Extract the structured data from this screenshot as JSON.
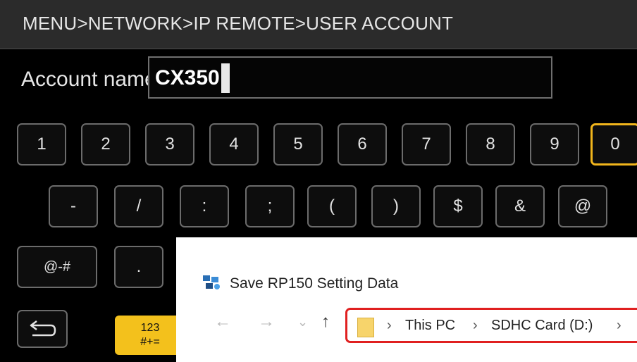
{
  "camera": {
    "breadcrumb": "MENU>NETWORK>IP REMOTE>USER ACCOUNT",
    "account_label": "Account name",
    "account_value": "CX350",
    "keys_row1": [
      "1",
      "2",
      "3",
      "4",
      "5",
      "6",
      "7",
      "8",
      "9",
      "0"
    ],
    "keys_row2": [
      "-",
      "/",
      ":",
      ";",
      "(",
      ")",
      "$",
      "&",
      "@"
    ],
    "keys_row3": [
      "@-#",
      "."
    ],
    "mode_key": {
      "top": "123",
      "bottom": "#+="
    },
    "back_icon": "return-arrow-icon",
    "selected_key": "0",
    "accent_color": "#f1b51c"
  },
  "dialog": {
    "title": "Save RP150 Setting Data",
    "nav": {
      "back": "←",
      "forward": "→",
      "history": "⌄",
      "up": "↑"
    },
    "path": [
      "This PC",
      "SDHC Card (D:)"
    ],
    "separator": "›",
    "highlight_color": "#e02020"
  }
}
